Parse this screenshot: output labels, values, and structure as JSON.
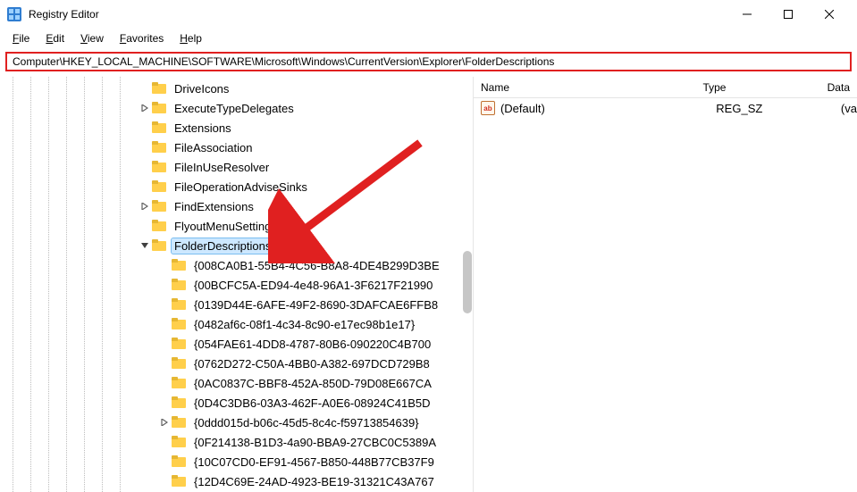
{
  "window": {
    "title": "Registry Editor"
  },
  "menu": {
    "file": "File",
    "edit": "Edit",
    "view": "View",
    "favorites": "Favorites",
    "help": "Help"
  },
  "address": "Computer\\HKEY_LOCAL_MACHINE\\SOFTWARE\\Microsoft\\Windows\\CurrentVersion\\Explorer\\FolderDescriptions",
  "columns": {
    "name": "Name",
    "type": "Type",
    "data": "Data"
  },
  "values": [
    {
      "name": "(Default)",
      "type": "REG_SZ",
      "data": "(value not set)"
    }
  ],
  "tree_display_data_cutoff": "(va",
  "tree": {
    "siblings": [
      {
        "label": "DriveIcons",
        "expander": ""
      },
      {
        "label": "ExecuteTypeDelegates",
        "expander": ">"
      },
      {
        "label": "Extensions",
        "expander": ""
      },
      {
        "label": "FileAssociation",
        "expander": ""
      },
      {
        "label": "FileInUseResolver",
        "expander": ""
      },
      {
        "label": "FileOperationAdviseSinks",
        "expander": ""
      },
      {
        "label": "FindExtensions",
        "expander": ">"
      },
      {
        "label": "FlyoutMenuSettings",
        "expander": ""
      }
    ],
    "selected": {
      "label": "FolderDescriptions",
      "expander": "v"
    },
    "children": [
      {
        "label": "{008CA0B1-55B4-4C56-B8A8-4DE4B299D3BE",
        "expander": ""
      },
      {
        "label": "{00BCFC5A-ED94-4e48-96A1-3F6217F21990",
        "expander": ""
      },
      {
        "label": "{0139D44E-6AFE-49F2-8690-3DAFCAE6FFB8",
        "expander": ""
      },
      {
        "label": "{0482af6c-08f1-4c34-8c90-e17ec98b1e17}",
        "expander": ""
      },
      {
        "label": "{054FAE61-4DD8-4787-80B6-090220C4B700",
        "expander": ""
      },
      {
        "label": "{0762D272-C50A-4BB0-A382-697DCD729B8",
        "expander": ""
      },
      {
        "label": "{0AC0837C-BBF8-452A-850D-79D08E667CA",
        "expander": ""
      },
      {
        "label": "{0D4C3DB6-03A3-462F-A0E6-08924C41B5D",
        "expander": ""
      },
      {
        "label": "{0ddd015d-b06c-45d5-8c4c-f59713854639}",
        "expander": ">"
      },
      {
        "label": "{0F214138-B1D3-4a90-BBA9-27CBC0C5389A",
        "expander": ""
      },
      {
        "label": "{10C07CD0-EF91-4567-B850-448B77CB37F9",
        "expander": ""
      },
      {
        "label": "{12D4C69E-24AD-4923-BE19-31321C43A767",
        "expander": ""
      }
    ]
  }
}
